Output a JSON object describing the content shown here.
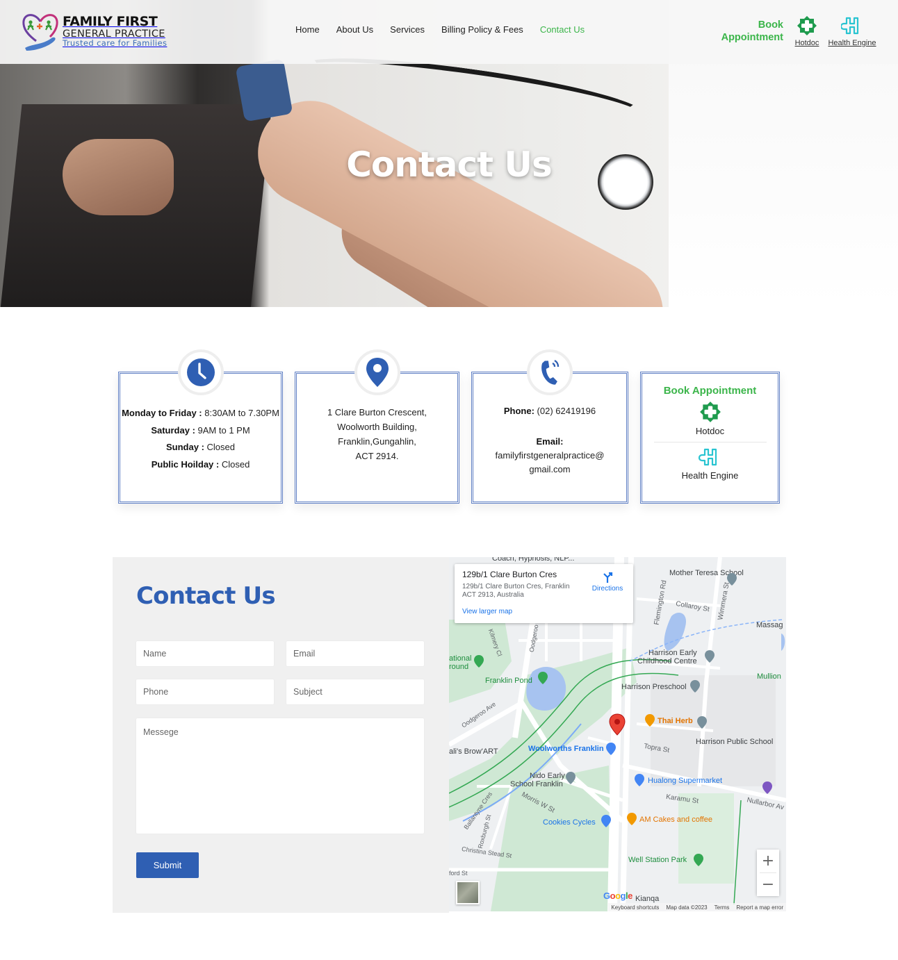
{
  "header": {
    "logo": {
      "line1": "FAMILY FIRST",
      "line2": "GENERAL PRACTICE",
      "tagline": "Trusted care for Families"
    },
    "nav": [
      {
        "label": "Home",
        "active": false
      },
      {
        "label": "About Us",
        "active": false
      },
      {
        "label": "Services",
        "active": false
      },
      {
        "label": "Billing Policy & Fees",
        "active": false
      },
      {
        "label": "Contact Us",
        "active": true
      }
    ],
    "book_line1": "Book",
    "book_line2": "Appointment",
    "hotdoc_label": "Hotdoc",
    "healthengine_label": "Health Engine"
  },
  "hero": {
    "title": "Contact Us"
  },
  "cards": {
    "hours": {
      "icon": "clock-icon",
      "rows": [
        {
          "day": "Monday to Friday :",
          "time": " 8:30AM to 7.30PM"
        },
        {
          "day": "Saturday :",
          "time": " 9AM to 1 PM"
        },
        {
          "day": "Sunday :",
          "time": " Closed"
        },
        {
          "day": "Public Hoilday :",
          "time": " Closed"
        }
      ]
    },
    "address": {
      "icon": "map-pin-icon",
      "lines": [
        "1 Clare Burton Crescent,",
        "Woolworth Building,",
        "Franklin,Gungahlin,",
        "ACT 2914."
      ]
    },
    "contact": {
      "icon": "phone-icon",
      "phone_label": "Phone:",
      "phone_value": " (02) 62419196",
      "email_label": "Email:",
      "email_line1": "familyfirstgeneralpractice@",
      "email_line2": "gmail.com"
    },
    "booking": {
      "title": "Book Appointment",
      "hotdoc_label": "Hotdoc",
      "healthengine_label": "Health Engine"
    }
  },
  "form": {
    "title": "Contact Us",
    "name_placeholder": "Name",
    "email_placeholder": "Email",
    "phone_placeholder": "Phone",
    "subject_placeholder": "Subject",
    "message_placeholder": "Messege",
    "submit_label": "Submit"
  },
  "map": {
    "place_title": "129b/1 Clare Burton Cres",
    "place_address": "129b/1 Clare Burton Cres, Franklin ACT 2913, Australia",
    "directions_label": "Directions",
    "larger_map_label": "View larger map",
    "zoom_in": "+",
    "zoom_out": "−",
    "google_logo": "Google",
    "footer": [
      "Keyboard shortcuts",
      "Map data ©2023",
      "Terms",
      "Report a map error"
    ],
    "labels": [
      {
        "text": "Coach, Hypnosis, NLP...",
        "kind": "dark"
      },
      {
        "text": "Mother Teresa School",
        "kind": "dark"
      },
      {
        "text": "Collaroy St",
        "kind": "street"
      },
      {
        "text": "Flemington Rd",
        "kind": "street"
      },
      {
        "text": "Wimmera St",
        "kind": "street"
      },
      {
        "text": "Massag",
        "kind": "dark"
      },
      {
        "text": "Harrison Early",
        "kind": "dark"
      },
      {
        "text": "Childhood Centre",
        "kind": "dark"
      },
      {
        "text": "Mullion",
        "kind": "green"
      },
      {
        "text": "ational",
        "kind": "green"
      },
      {
        "text": "round",
        "kind": "green"
      },
      {
        "text": "Kilmery Cl",
        "kind": "street"
      },
      {
        "text": "Oodgeroo Ave",
        "kind": "street"
      },
      {
        "text": "Franklin Pond",
        "kind": "green"
      },
      {
        "text": "Harrison Preschool",
        "kind": "dark"
      },
      {
        "text": "Thai Herb",
        "kind": "orange"
      },
      {
        "text": "Harrison Public School",
        "kind": "dark"
      },
      {
        "text": "Topra St",
        "kind": "street"
      },
      {
        "text": "Woolworths Franklin",
        "kind": "blue"
      },
      {
        "text": "ali's Brow'ART",
        "kind": "dark"
      },
      {
        "text": "Nido Early",
        "kind": "dark"
      },
      {
        "text": "School Franklin",
        "kind": "dark"
      },
      {
        "text": "Hualong Supermarket",
        "kind": "blue"
      },
      {
        "text": "Karamu St",
        "kind": "street"
      },
      {
        "text": "Nullarbor Av",
        "kind": "street"
      },
      {
        "text": "Morris W St",
        "kind": "street"
      },
      {
        "text": "Ballantyne Cres",
        "kind": "street"
      },
      {
        "text": "Roxburgh St",
        "kind": "street"
      },
      {
        "text": "Cookies Cycles",
        "kind": "blue"
      },
      {
        "text": "AM Cakes and coffee",
        "kind": "orange"
      },
      {
        "text": "Christina Stead St",
        "kind": "street"
      },
      {
        "text": "Well Station Park",
        "kind": "green"
      },
      {
        "text": "ford St",
        "kind": "street"
      },
      {
        "text": "Kianqa",
        "kind": "dark"
      },
      {
        "text": "Oodgeroo",
        "kind": "street"
      }
    ]
  },
  "colors": {
    "brand_blue": "#2f5fb3",
    "brand_green": "#3bb54a",
    "healthengine_teal": "#29c4d1",
    "hotdoc_green": "#1f9b4e"
  }
}
